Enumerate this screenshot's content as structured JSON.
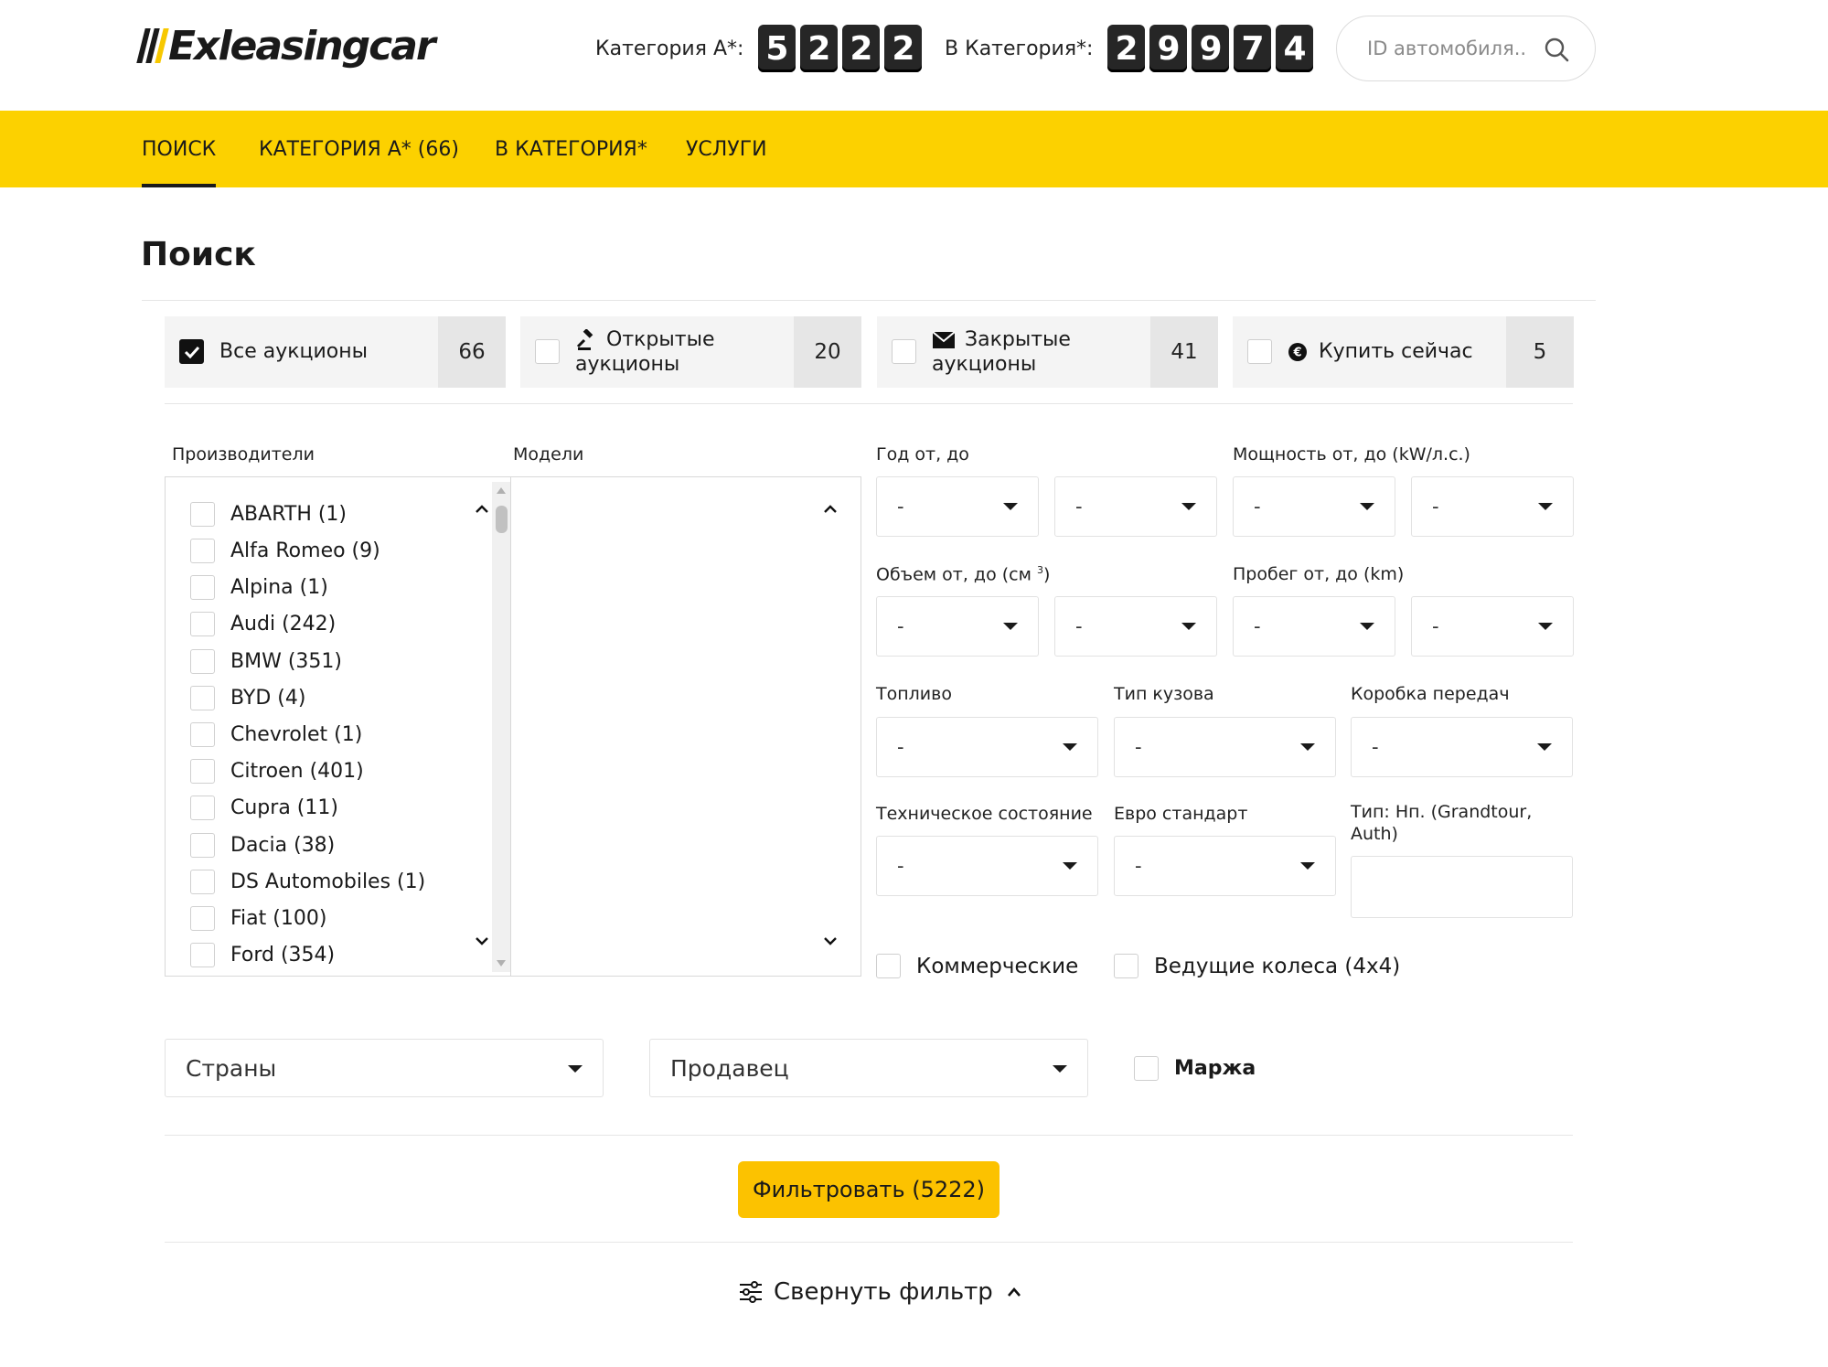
{
  "header": {
    "logo_text": "Exleasingcar",
    "counter_a": {
      "label": "Категория А*:",
      "digits": [
        "5",
        "2",
        "2",
        "2"
      ]
    },
    "counter_b": {
      "label": "В Категория*:",
      "digits": [
        "2",
        "9",
        "9",
        "7",
        "4"
      ]
    },
    "search_placeholder": "ID автомобиля.."
  },
  "nav": {
    "items": [
      {
        "label": "ПОИСК",
        "active": true
      },
      {
        "label": "КАТЕГОРИЯ А* (66)",
        "active": false
      },
      {
        "label": "В КАТЕГОРИЯ*",
        "active": false
      },
      {
        "label": "УСЛУГИ",
        "active": false
      }
    ],
    "background_color": "#fcd100"
  },
  "page": {
    "title": "Поиск"
  },
  "auctions": [
    {
      "label": "Все аукционы",
      "count": "66",
      "checked": true,
      "icon": "none"
    },
    {
      "label_line1": "Открытые",
      "label_line2": "аукционы",
      "count": "20",
      "checked": false,
      "icon": "gavel-icon"
    },
    {
      "label_line1": "Закрытые",
      "label_line2": "аукционы",
      "count": "41",
      "checked": false,
      "icon": "envelope-icon"
    },
    {
      "label": "Купить сейчас",
      "count": "5",
      "checked": false,
      "icon": "euro-coin-icon"
    }
  ],
  "filters": {
    "makes_label": "Производители",
    "models_label": "Модели",
    "makes": [
      "ABARTH (1)",
      "Alfa Romeo (9)",
      "Alpina (1)",
      "Audi (242)",
      "BMW (351)",
      "BYD (4)",
      "Chevrolet (1)",
      "Citroen (401)",
      "Cupra (11)",
      "Dacia (38)",
      "DS Automobiles (1)",
      "Fiat (100)",
      "Ford (354)"
    ],
    "year_label": "Год от, до",
    "power_label": "Мощность от, до (kW/л.с.)",
    "volume_label": "Объем от, до (см ",
    "volume_sup": "3",
    "volume_label_end": ")",
    "mileage_label": "Пробег от, до (km)",
    "fuel_label": "Топливо",
    "body_label": "Тип кузова",
    "gearbox_label": "Коробка передач",
    "condition_label": "Техническое состояние",
    "euro_label": "Евро стандарт",
    "type_label_line1": "Тип: Нп. (Grandtour,",
    "type_label_line2": "Auth)",
    "select_value": "-",
    "commercial_label": "Коммерческие",
    "drive_label": "Ведущие колеса (4x4)",
    "countries_label": "Страны",
    "seller_label": "Продавец",
    "margin_label": "Маржа",
    "filter_button": "Фильтровать (5222)",
    "collapse_label": "Свернуть фильтр"
  },
  "colors": {
    "accent": "#fcd100",
    "button": "#fcc200",
    "counter_bg": "#262626"
  }
}
